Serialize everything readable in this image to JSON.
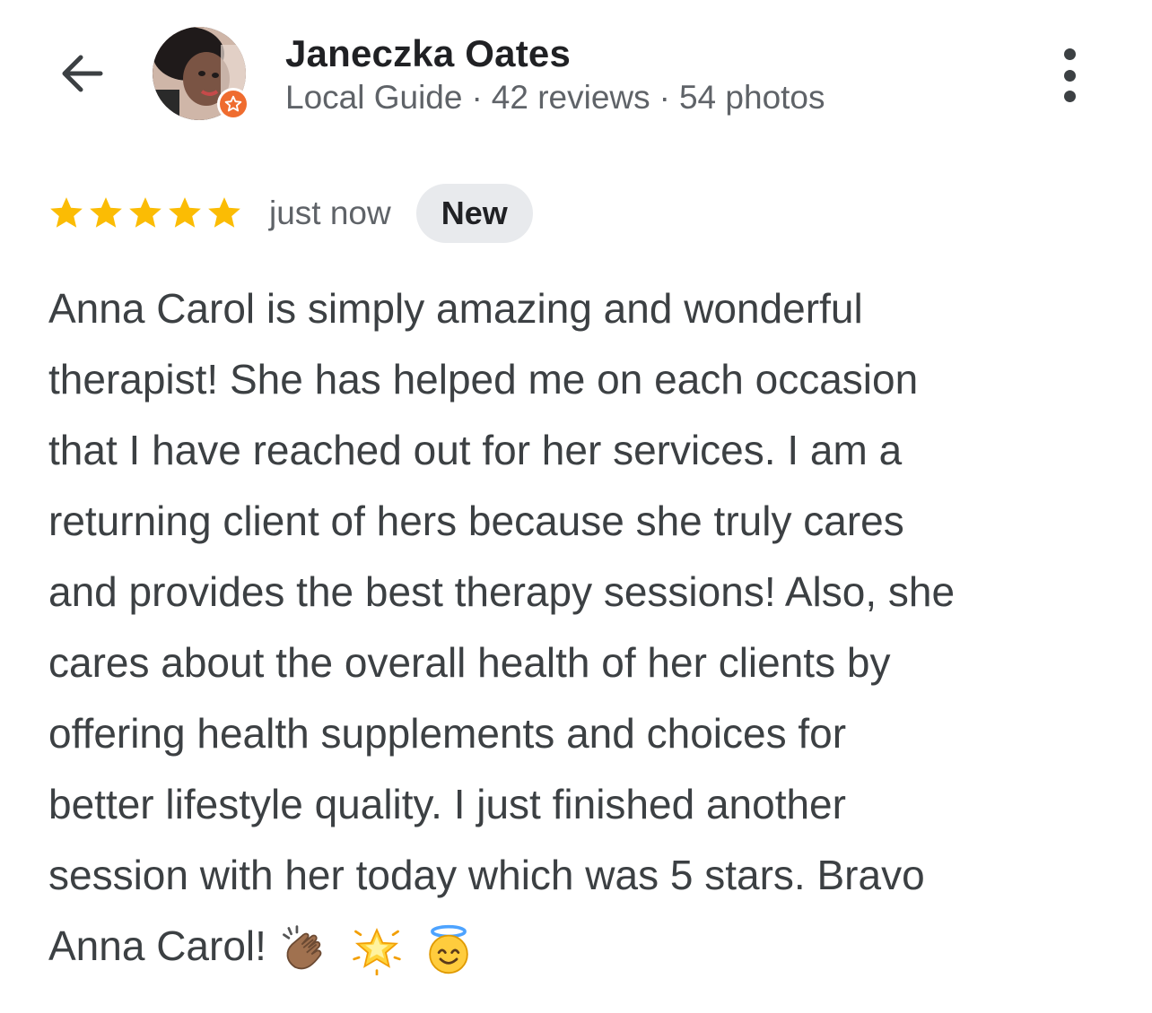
{
  "header": {
    "back_icon": "arrow-back-icon",
    "avatar_icon": "avatar",
    "badge_icon": "local-guide-star-icon",
    "name": "Janeczka Oates",
    "guide_label": "Local Guide",
    "separator": "·",
    "reviews": "42 reviews",
    "photos": "54 photos",
    "more_icon": "more-vert-icon"
  },
  "review": {
    "rating": 5,
    "rating_max": 5,
    "star_color": "#fbbc04",
    "time": "just now",
    "badge": "New",
    "lines": [
      "Anna Carol is simply amazing and wonderful",
      "therapist! She has helped me on each occasion",
      "that I have reached out for her services. I am a",
      "returning client of hers because she truly cares",
      "and provides the best therapy sessions! Also, she",
      "cares about the overall health of her clients by",
      "offering health supplements and choices for",
      "better lifestyle quality. I just finished another",
      "session with her today which was 5 stars. Bravo",
      "Anna Carol!"
    ],
    "emojis": [
      "clapping-hands-emoji",
      "glowing-star-emoji",
      "smiling-face-with-halo-emoji"
    ]
  },
  "colors": {
    "badge_orange": "#ef6c2f",
    "text_primary": "#202124",
    "text_secondary": "#5f6368",
    "chip_bg": "#e8eaed"
  }
}
